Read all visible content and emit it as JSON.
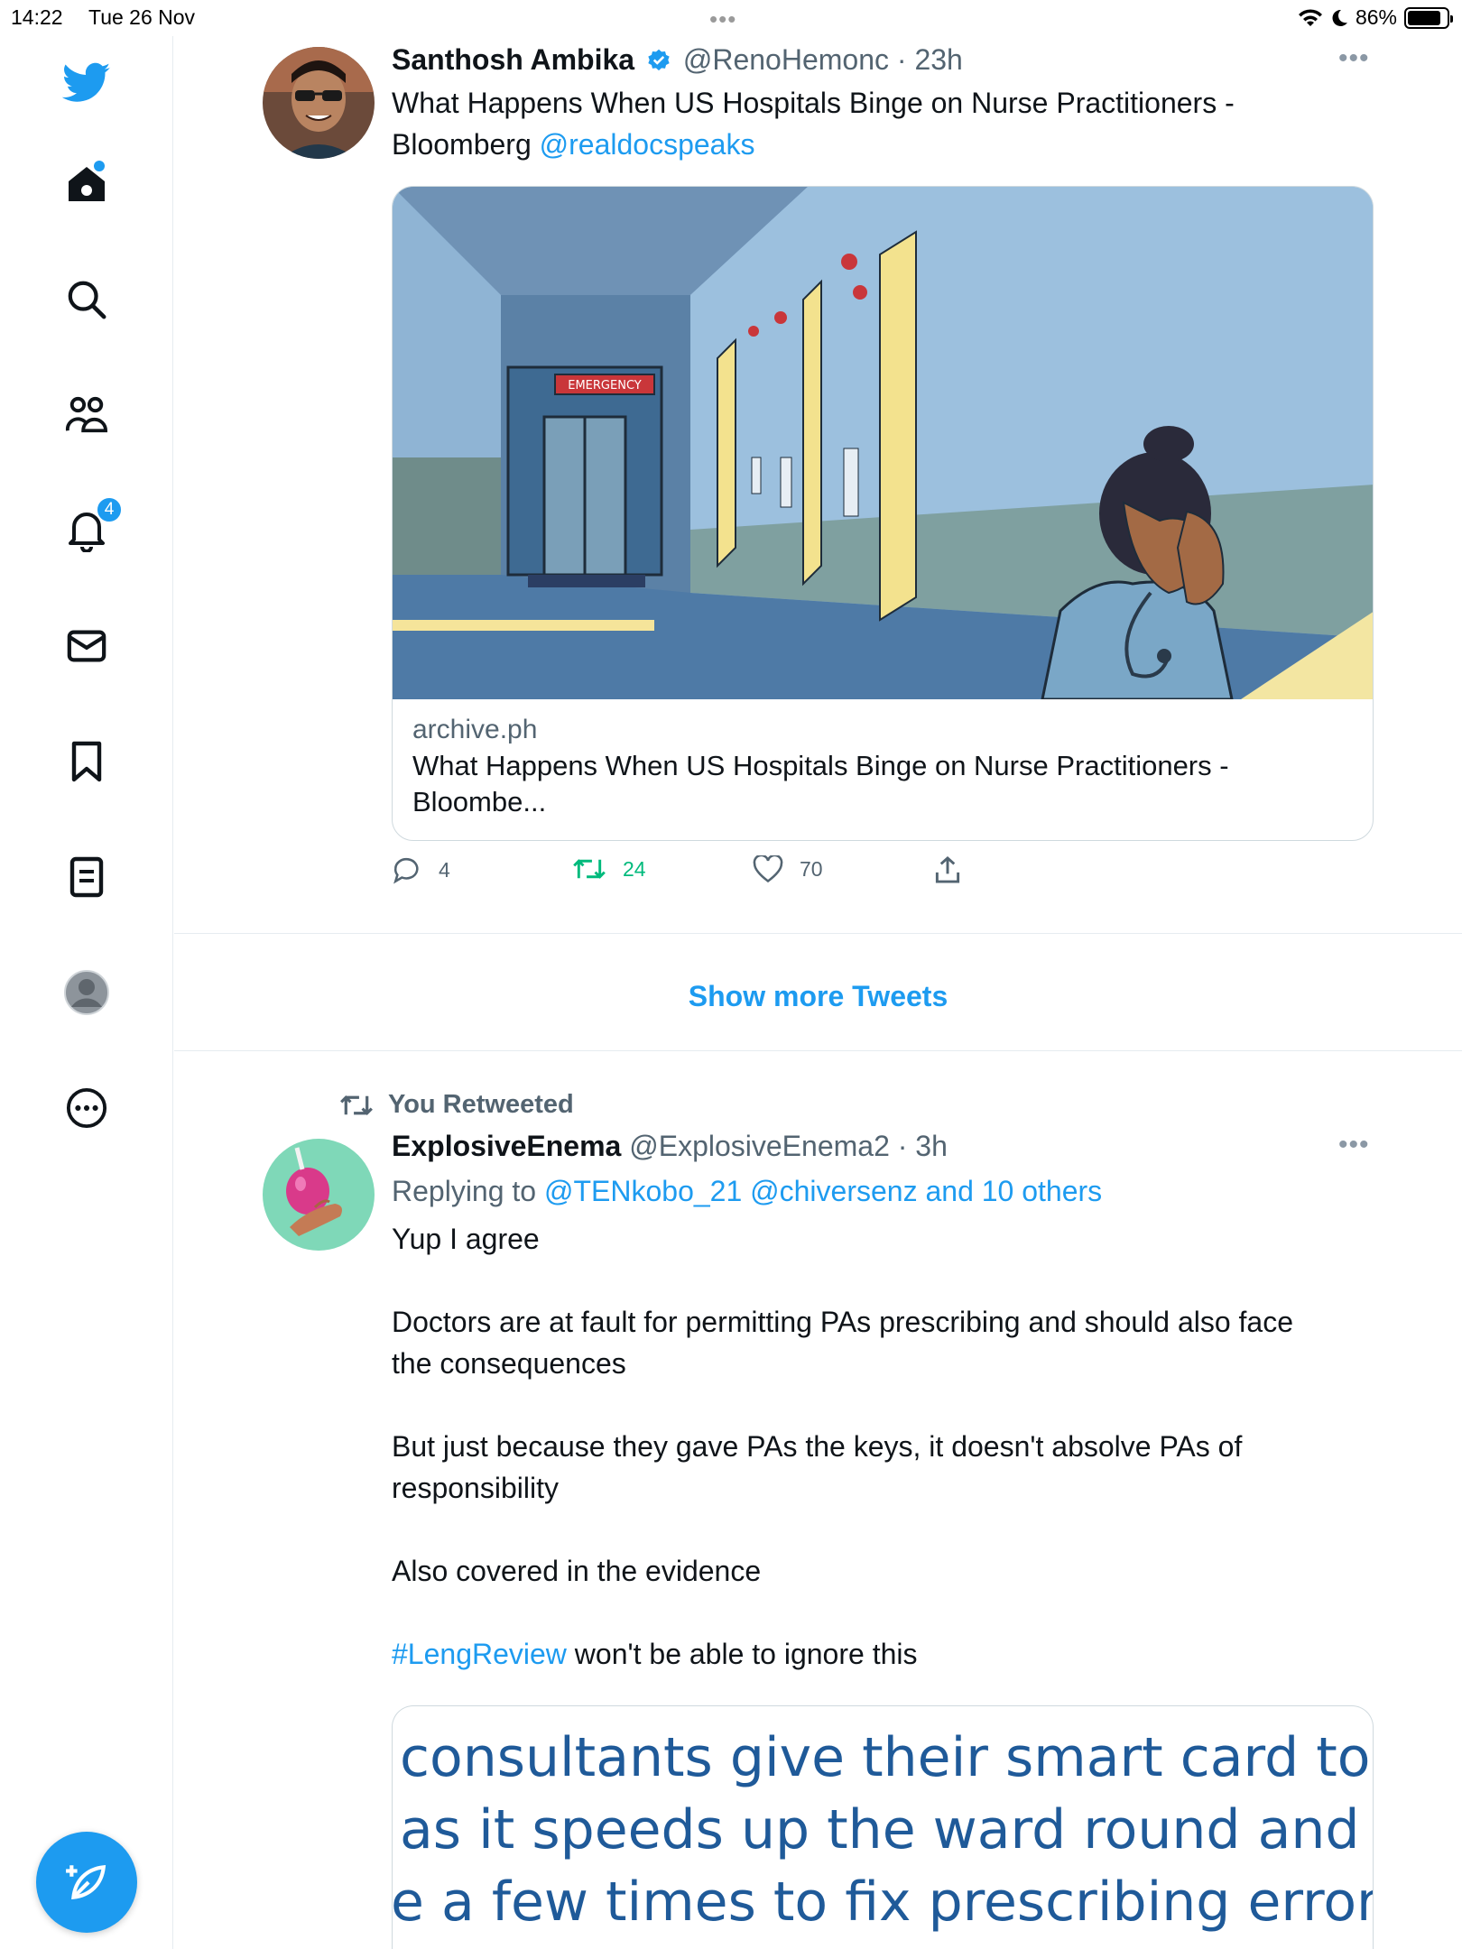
{
  "status_bar": {
    "time": "14:22",
    "date": "Tue 26 Nov",
    "battery": "86%",
    "battery_level": 0.86
  },
  "sidebar": {
    "notifications_badge": "4",
    "icons": [
      "twitter-logo-icon",
      "home-icon",
      "search-icon",
      "communities-icon",
      "notifications-icon",
      "messages-icon",
      "bookmarks-icon",
      "lists-icon",
      "profile-icon",
      "more-icon",
      "compose-icon"
    ]
  },
  "tweet1": {
    "name": "Santhosh Ambika",
    "handle": "@RenoHemonc",
    "time": "· 23h",
    "text_line1": "What Happens When US Hospitals Binge on Nurse Practitioners -",
    "text_line2_prefix": "Bloomberg ",
    "mention": "@realdocspeaks",
    "card": {
      "domain": "archive.ph",
      "title_line1": "What Happens When US Hospitals Binge on Nurse Practitioners -",
      "title_line2": "Bloombe...",
      "sign_text": "EMERGENCY"
    },
    "replies": "4",
    "retweets": "24",
    "likes": "70"
  },
  "show_more": "Show more Tweets",
  "tweet2": {
    "retweeted_label": "You Retweeted",
    "name": "ExplosiveEnema",
    "handle": "@ExplosiveEnema2",
    "time": "· 3h",
    "replying_prefix": "Replying to ",
    "replying_to": "@TENkobo_21 @chiversenz and 10 others",
    "line1": "Yup I agree",
    "line2": "Doctors are at fault for permitting PAs prescribing and should also face",
    "line3": "the consequences",
    "line4": "But just because they gave PAs the keys, it doesn't absolve PAs of",
    "line5": "responsibility",
    "line6": "Also covered in the evidence",
    "hashtag": "#LengReview",
    "line7_rest": " won't be able to ignore this",
    "image_text": {
      "line1": "consultants give their smart card to th",
      "line2": "as it speeds up the ward round and pre",
      "line3": "e a few times to fix prescribing errors s"
    }
  },
  "colors": {
    "accent": "#1d9bf0",
    "retweet_green": "#00ba7c",
    "secondary_text": "#536471"
  }
}
